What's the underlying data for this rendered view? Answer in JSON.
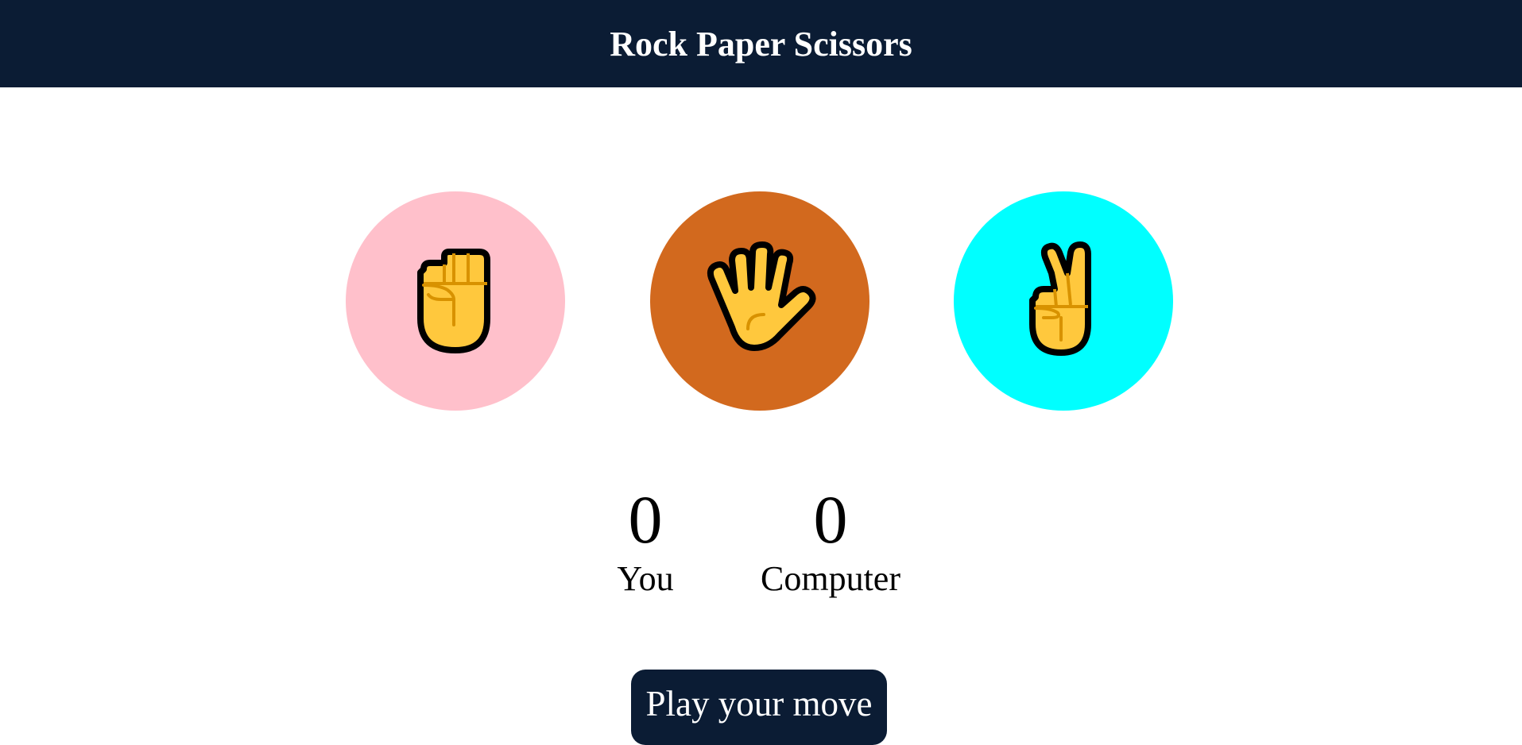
{
  "header": {
    "title": "Rock Paper Scissors"
  },
  "choices": [
    {
      "name": "rock",
      "icon": "raised-fist-icon",
      "color": "#ffc0cb"
    },
    {
      "name": "paper",
      "icon": "raised-hand-icon",
      "color": "#d2691e"
    },
    {
      "name": "scissors",
      "icon": "victory-hand-icon",
      "color": "#00ffff"
    }
  ],
  "scores": {
    "you": {
      "value": "0",
      "label": "You"
    },
    "computer": {
      "value": "0",
      "label": "Computer"
    }
  },
  "play_button": {
    "label": "Play your move"
  },
  "colors": {
    "header_bg": "#0b1c34",
    "skin": "#ffc83d",
    "skin_line": "#d89200",
    "outline": "#000000"
  }
}
